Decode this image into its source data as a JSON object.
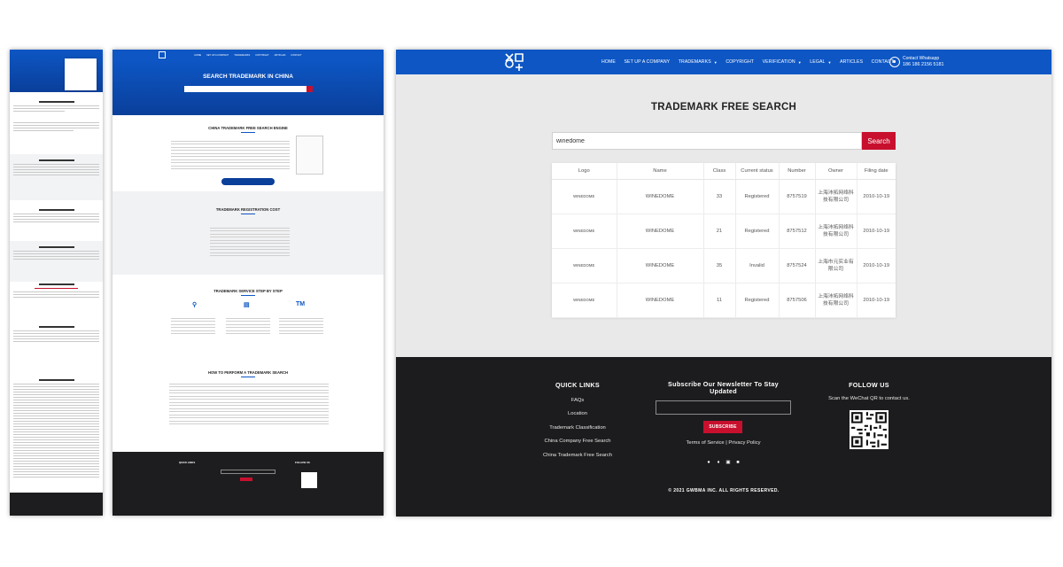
{
  "nav": {
    "items": [
      {
        "label": "HOME",
        "dropdown": false
      },
      {
        "label": "SET UP A COMPANY",
        "dropdown": false
      },
      {
        "label": "TRADEMARKS",
        "dropdown": true
      },
      {
        "label": "COPYRIGHT",
        "dropdown": false
      },
      {
        "label": "VERIFICATION",
        "dropdown": true
      },
      {
        "label": "LEGAL",
        "dropdown": true
      },
      {
        "label": "ARTICLES",
        "dropdown": false
      },
      {
        "label": "CONTACT",
        "dropdown": false
      }
    ],
    "whatsapp_label": "Contact Whatsapp",
    "whatsapp_number": "186 186 2156 5181"
  },
  "main": {
    "title": "TRADEMARK FREE SEARCH",
    "search_value": "winedome",
    "search_button": "Search"
  },
  "table": {
    "headers": [
      "Logo",
      "Name",
      "Class",
      "Current status",
      "Number",
      "Owner",
      "Filing date"
    ],
    "rows": [
      {
        "logo": "WINEDOME",
        "name": "WINEDOME",
        "class": "33",
        "status": "Registered",
        "number": "8757519",
        "owner": "上海沛拓网络科技有限公司",
        "date": "2010-10-19"
      },
      {
        "logo": "WINEDOME",
        "name": "WINEDOME",
        "class": "21",
        "status": "Registered",
        "number": "8757512",
        "owner": "上海沛拓网络科技有限公司",
        "date": "2010-10-19"
      },
      {
        "logo": "WINEDOME",
        "name": "WINEDOME",
        "class": "35",
        "status": "Invalid",
        "number": "8757524",
        "owner": "上海市元实业有限公司",
        "date": "2010-10-19"
      },
      {
        "logo": "WINEDOME",
        "name": "WINEDOME",
        "class": "11",
        "status": "Registered",
        "number": "8757506",
        "owner": "上海沛拓网络科技有限公司",
        "date": "2010-10-19"
      }
    ]
  },
  "footer": {
    "quick_links_title": "QUICK LINKS",
    "links": [
      "FAQs",
      "Location",
      "Trademark Classification",
      "China Company Free Search",
      "China Trademark Free Search"
    ],
    "newsletter_title": "Subscribe Our Newsletter To Stay Updated",
    "subscribe_label": "SUBSCRIBE",
    "terms": "Terms of Service",
    "separator": "|",
    "privacy": "Privacy Policy",
    "follow_title": "FOLLOW US",
    "qr_text": "Scan the WeChat QR to contact us.",
    "copyright": "© 2021 GWBMA INC. ALL RIGHTS RESERVED.",
    "social_icons": [
      "facebook-icon",
      "twitter-icon",
      "instagram-icon",
      "linkedin-icon"
    ]
  },
  "middle": {
    "hero_title": "SEARCH TRADEMARK IN CHINA",
    "sec1_title": "CHINA TRADEMARK FREE SEARCH ENGINE",
    "sec2_title": "TRADEMARK REGISTRATION COST",
    "sec3_title": "TRADEMARK SERVICE STEP BY STEP",
    "sec4_title": "HOW TO PERFORM A TRADEMARK SEARCH",
    "tm_icon": "TM"
  },
  "colors": {
    "brand_blue": "#0d56c4",
    "accent_red": "#c8102e",
    "footer_dark": "#1c1c1e"
  }
}
